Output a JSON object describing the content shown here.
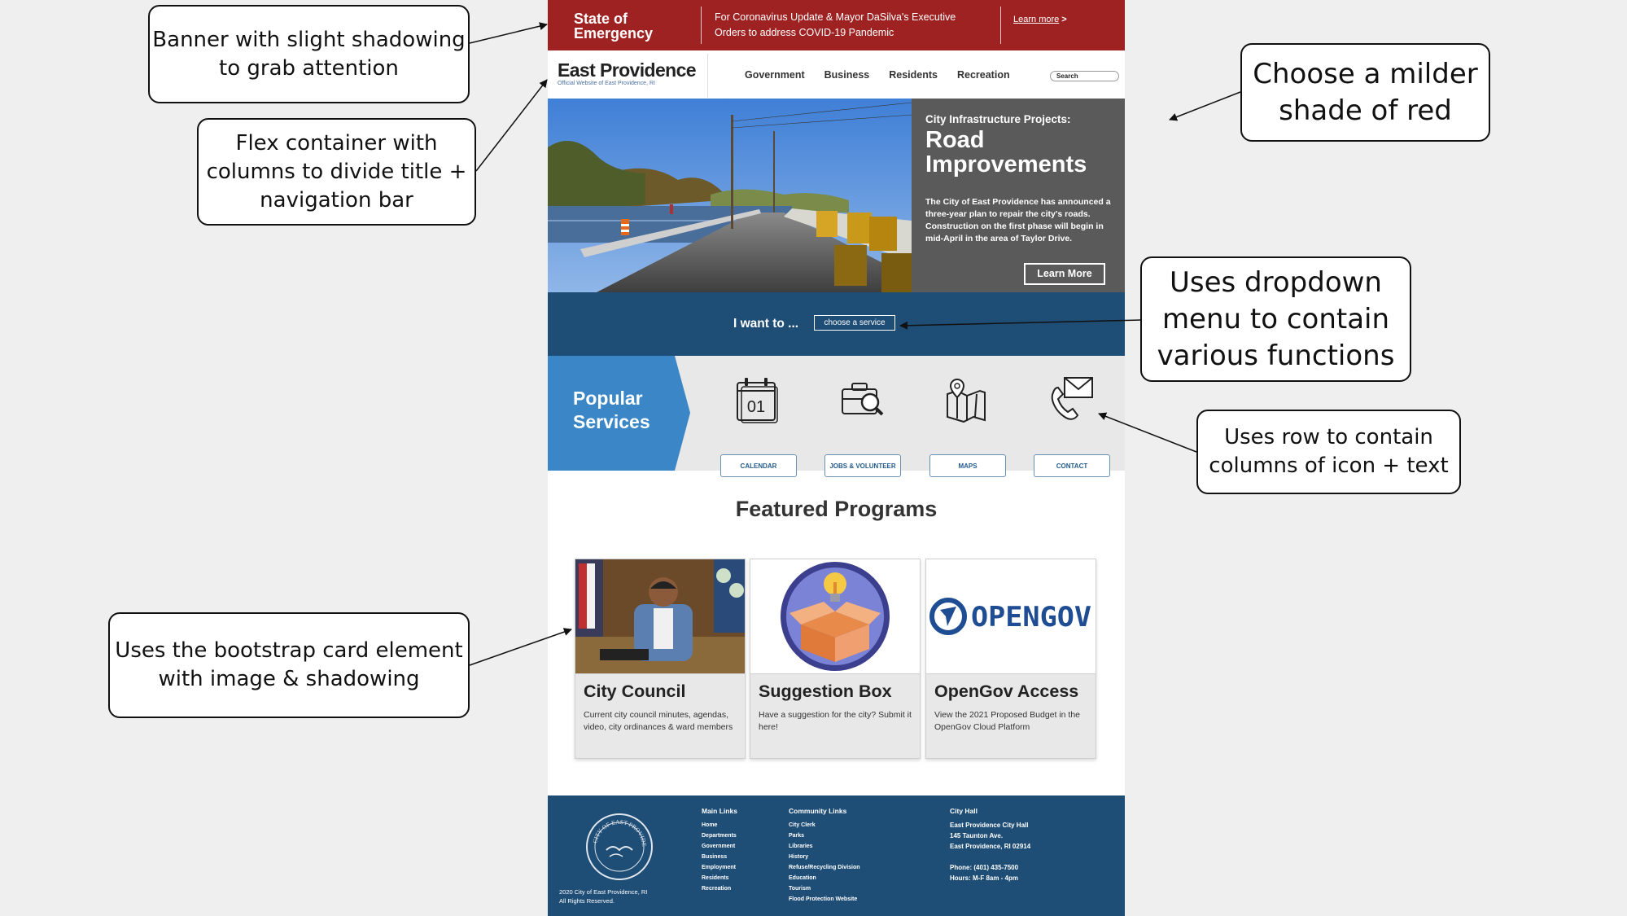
{
  "alert": {
    "title": "State of Emergency",
    "message": "For Coronavirus Update & Mayor DaSilva's Executive Orders to address COVID-19 Pandemic",
    "link": "Learn more",
    "link_chevron": ">"
  },
  "header": {
    "logo": "East Providence",
    "subtitle": "Official Website of East Providence, RI",
    "nav": [
      "Government",
      "Business",
      "Residents",
      "Recreation"
    ],
    "search_placeholder": "Search"
  },
  "hero": {
    "kicker": "City Infrastructure Projects:",
    "headline": "Road Improvements",
    "body": "The City of East Providence has announced a three-year plan to repair the city's roads. Construction on the first phase will begin in mid-April in the area of Taylor Drive.",
    "button": "Learn More"
  },
  "iwant": {
    "label": "I want to ...",
    "select_value": "choose a service"
  },
  "popular": {
    "title": "Popular Services",
    "services": [
      {
        "label": "CALENDAR",
        "icon": "calendar-icon"
      },
      {
        "label": "JOBS & VOLUNTEER",
        "icon": "briefcase-search-icon"
      },
      {
        "label": "MAPS",
        "icon": "map-icon"
      },
      {
        "label": "CONTACT",
        "icon": "phone-envelope-icon"
      }
    ],
    "calendar_day": "01"
  },
  "featured": {
    "heading": "Featured Programs",
    "cards": [
      {
        "title": "City Council",
        "desc": "Current city council minutes, agendas, video, city ordinances & ward members"
      },
      {
        "title": "Suggestion Box",
        "desc": "Have a suggestion for the city? Submit it here!"
      },
      {
        "title": "OpenGov Access",
        "desc": "View the 2021 Proposed Budget in the OpenGov Cloud Platform"
      }
    ],
    "opengov_logo": "OPENGOV"
  },
  "footer": {
    "copyright_1": "2020 City of East Providence, RI",
    "copyright_2": "All Rights Reserved.",
    "main_links": {
      "title": "Main Links",
      "items": [
        "Home",
        "Departments",
        "Government",
        "Business",
        "Employment",
        "Residents",
        "Recreation"
      ]
    },
    "community_links": {
      "title": "Community Links",
      "items": [
        "City Clerk",
        "Parks",
        "Libraries",
        "History",
        "Refuse/Recycling Division",
        "Education",
        "Tourism",
        "Flood Protection Website"
      ]
    },
    "city_hall": {
      "title": "City Hall",
      "lines": [
        "East Providence City Hall",
        "145 Taunton Ave.",
        "East Providence, RI 02914",
        "",
        "Phone: (401) 435-7500",
        "Hours: M-F 8am - 4pm"
      ]
    },
    "seal_text": "CITY OF EAST PROVIDENCE"
  },
  "annotations": {
    "banner": [
      "Banner with slight shadowing",
      "to grab attention"
    ],
    "flex": [
      "Flex container with",
      "columns to divide title +",
      "navigation bar"
    ],
    "red": [
      "Choose a milder",
      "shade of red"
    ],
    "dropdown": [
      "Uses dropdown",
      "menu to contain",
      "various functions"
    ],
    "row": [
      "Uses row to contain",
      "columns of icon + text"
    ],
    "card": [
      "Uses the bootstrap card element",
      "with image & shadowing"
    ]
  },
  "colors": {
    "alert_red": "#9f2222",
    "navy": "#1e4d76",
    "services_blue": "#3b86c6",
    "hero_gray": "#5a5a5a"
  }
}
